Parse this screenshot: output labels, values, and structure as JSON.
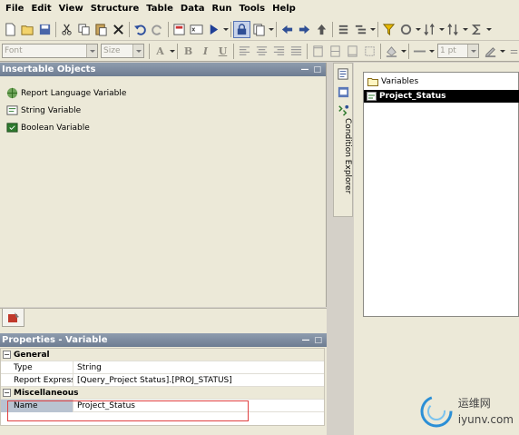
{
  "menu": [
    "File",
    "Edit",
    "View",
    "Structure",
    "Table",
    "Data",
    "Run",
    "Tools",
    "Help"
  ],
  "toolbar2": {
    "font_placeholder": "Font",
    "size_placeholder": "Size",
    "line_width": "1 pt"
  },
  "insertable_panel": {
    "title": "Insertable Objects",
    "items": [
      {
        "label": "Report Language Variable",
        "icon": "report-language-variable-icon"
      },
      {
        "label": "String Variable",
        "icon": "string-variable-icon"
      },
      {
        "label": "Boolean Variable",
        "icon": "boolean-variable-icon"
      }
    ]
  },
  "properties_panel": {
    "title": "Properties - Variable",
    "groups": [
      {
        "name": "General",
        "rows": [
          {
            "name": "Type",
            "value": "String"
          },
          {
            "name": "Report Expression",
            "value": "[Query_Project Status].[PROJ_STATUS]"
          }
        ]
      },
      {
        "name": "Miscellaneous",
        "rows": [
          {
            "name": "Name",
            "value": "Project_Status"
          }
        ]
      }
    ]
  },
  "side_tab": {
    "label": "Condition Explorer"
  },
  "variables": {
    "folder": "Variables",
    "selected": "Project_Status"
  },
  "watermark": {
    "text_cn": "运维网",
    "text_en": "iyunv.com"
  },
  "colors": {
    "title_bar": "#7a889d",
    "selection": "#000000",
    "highlight_border": "#e04040",
    "watermark_blue": "#2b8fd6"
  }
}
